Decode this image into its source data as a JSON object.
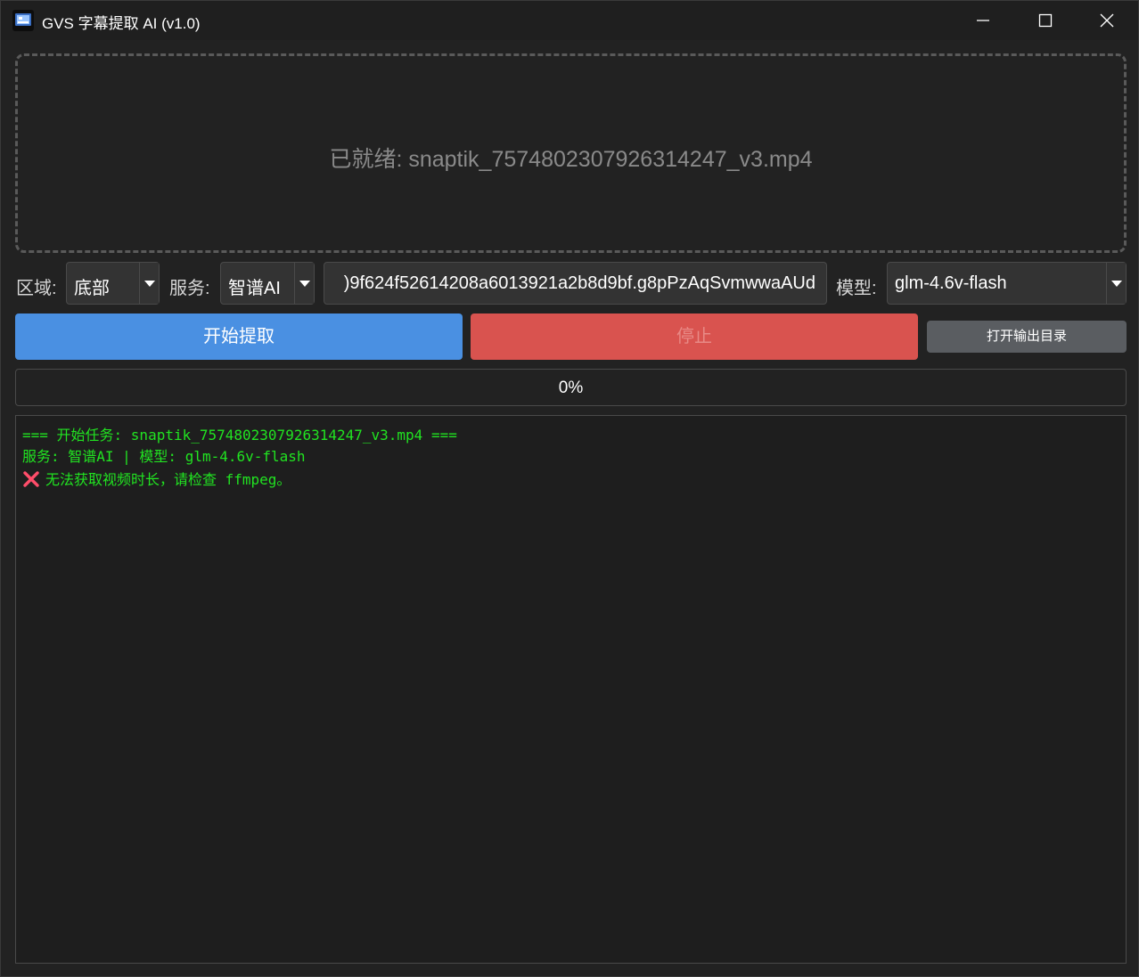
{
  "window": {
    "title": "GVS 字幕提取 AI (v1.0)"
  },
  "dropzone": {
    "status": "已就绪: snaptik_7574802307926314247_v3.mp4"
  },
  "controls": {
    "region_label": "区域:",
    "region_value": "底部",
    "service_label": "服务:",
    "service_value": "智谱AI",
    "api_key_value": ")9f624f52614208a6013921a2b8d9bf.g8pPzAqSvmwwaAUd",
    "model_label": "模型:",
    "model_value": "glm-4.6v-flash"
  },
  "buttons": {
    "start": "开始提取",
    "stop": "停止",
    "open_output": "打开输出目录"
  },
  "progress": {
    "value": 0,
    "text": "0%"
  },
  "log": {
    "lines": [
      "=== 开始任务: snaptik_7574802307926314247_v3.mp4 ===",
      "服务: 智谱AI | 模型: glm-4.6v-flash",
      "无法获取视频时长，请检查 ffmpeg。"
    ]
  },
  "colors": {
    "accent": "#4a90e2",
    "danger": "#d9534f",
    "log_text": "#21e321",
    "error_icon": "#ff4d6a"
  }
}
